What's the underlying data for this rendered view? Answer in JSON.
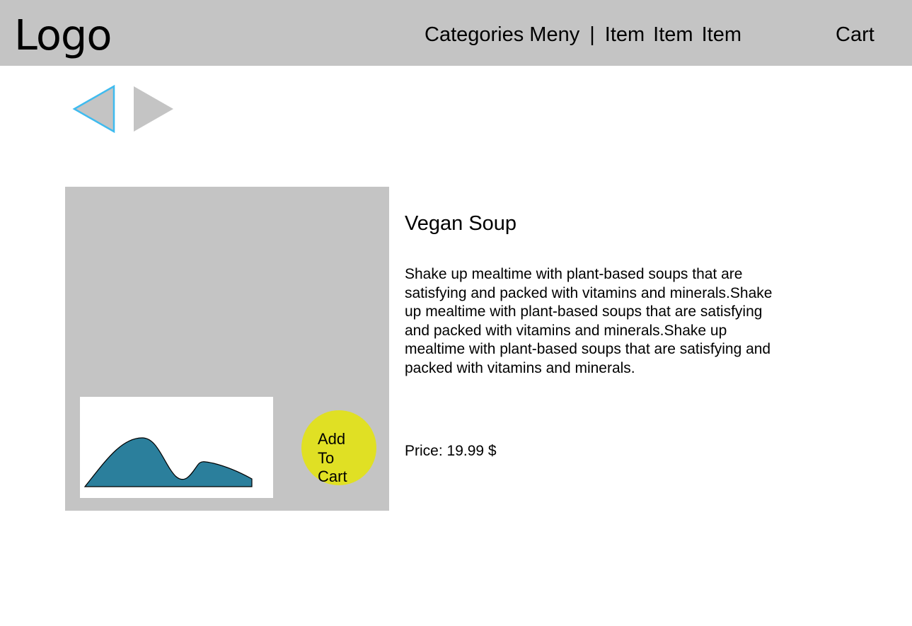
{
  "header": {
    "logo": "Logo",
    "nav": {
      "categories": "Categories Meny",
      "separator": "|",
      "items": [
        "Item",
        "Item",
        "Item"
      ]
    },
    "cart": "Cart"
  },
  "carousel": {
    "prev_icon": "triangle-left-icon",
    "next_icon": "triangle-right-icon",
    "prev_selected": true
  },
  "product": {
    "title": "Vegan Soup",
    "description": "Shake up mealtime with plant-based soups that are satisfying and packed with vitamins and minerals.Shake up mealtime with plant-based soups that are satisfying and packed with vitamins and minerals.Shake up mealtime with plant-based soups that are satisfying and packed with vitamins and minerals.",
    "price": "Price: 19.99 $",
    "add_to_cart": {
      "lines": [
        "Add",
        "To",
        "Cart"
      ]
    },
    "image_icon": "image-placeholder-icon"
  },
  "colors": {
    "header_bg": "#c4c4c4",
    "placeholder_gray": "#c4c4c4",
    "add_to_cart_bg": "#e0e024",
    "image_fill": "#2b7f9c",
    "selected_outline": "#3fbbef"
  }
}
